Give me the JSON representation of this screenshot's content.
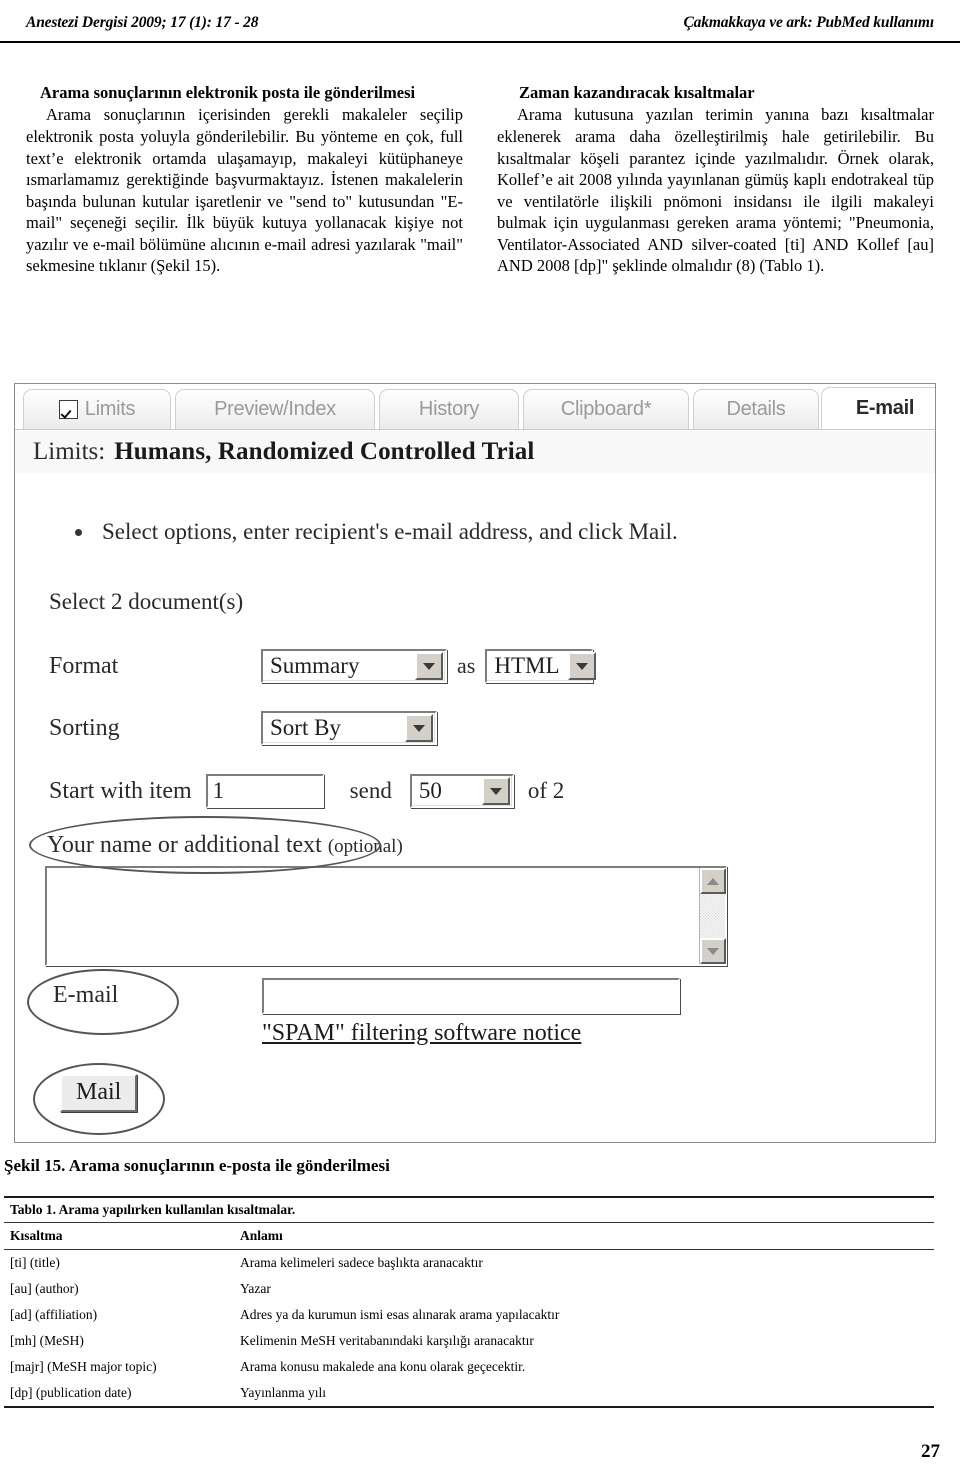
{
  "header": {
    "left": "Anestezi Dergisi 2009; 17 (1): 17 - 28",
    "right": "Çakmakkaya ve ark: PubMed kullanımı"
  },
  "left_column": {
    "heading": "Arama sonuçlarının elektronik posta ile gönderilmesi",
    "paragraph": "Arama sonuçlarının içerisinden gerekli makaleler seçilip elektronik posta yoluyla gönderilebilir. Bu yönteme en çok, full text’e elektronik ortamda ulaşamayıp, makaleyi kütüphaneye ısmarlamamız gerektiğinde başvurmaktayız. İstenen makalelerin başında bulunan kutular işaretlenir ve \"send to\" kutusundan \"E-mail\" seçeneği seçilir.  İlk büyük kutuya yollanacak kişiye not yazılır ve e-mail bölümüne alıcının e-mail adresi yazılarak \"mail\" sekmesine tıklanır (Şekil 15)."
  },
  "right_column": {
    "heading": "Zaman kazandıracak kısaltmalar",
    "paragraph": "Arama kutusuna yazılan terimin yanına bazı kısaltmalar eklenerek arama daha özelleştirilmiş hale getirilebilir. Bu kısaltmalar köşeli parantez içinde yazılmalıdır. Örnek olarak, Kollef’e ait 2008 yılında yayınlanan gümüş kaplı endotrakeal tüp ve ventilatörle ilişkili pnömoni insidansı ile ilgili makaleyi bulmak için uygulanması gereken arama yöntemi; \"Pneumonia, Ventilator-Associated AND silver-coated [ti] AND Kollef [au] AND 2008 [dp]\" şeklinde olmalıdır (8) (Tablo 1)."
  },
  "pubmed_figure": {
    "tabs": [
      {
        "label": "Limits",
        "has_checkbox": true,
        "checked": true,
        "active": false
      },
      {
        "label": "Preview/Index",
        "has_checkbox": false,
        "active": false
      },
      {
        "label": "History",
        "has_checkbox": false,
        "active": false
      },
      {
        "label": "Clipboard*",
        "has_checkbox": false,
        "active": false
      },
      {
        "label": "Details",
        "has_checkbox": false,
        "active": false
      },
      {
        "label": "E-mail",
        "has_checkbox": false,
        "active": true
      }
    ],
    "limits_bar": {
      "label": "Limits:",
      "value": "Humans, Randomized Controlled Trial"
    },
    "instruction": "Select options, enter recipient's e-mail address, and click Mail.",
    "select_count": "Select 2 document(s)",
    "format_row": {
      "label": "Format",
      "format_value": "Summary",
      "as_word": "as",
      "output_value": "HTML"
    },
    "sorting_row": {
      "label": "Sorting",
      "value": "Sort By"
    },
    "start_row": {
      "label": "Start with item",
      "item_value": "1",
      "send_word": "send",
      "count_value": "50",
      "of_word": "of 2"
    },
    "name_note": {
      "main": "Your name or additional text",
      "optional": "(optional)"
    },
    "textarea_value": "",
    "email_label": "E-mail",
    "email_value": "",
    "spam_notice": "\"SPAM\" filtering software notice",
    "mail_button": "Mail",
    "annotations": [
      "ellipse-around-name-note",
      "ellipse-around-email-label",
      "ellipse-around-mail-button"
    ]
  },
  "figure_caption": "Şekil 15. Arama sonuçlarının e-posta ile gönderilmesi",
  "table": {
    "title": "Tablo 1. Arama yapılırken kullanılan kısaltmalar.",
    "headers": [
      "Kısaltma",
      "Anlamı"
    ],
    "rows": [
      [
        "[ti] (title)",
        "Arama kelimeleri sadece başlıkta aranacaktır"
      ],
      [
        "[au] (author)",
        "Yazar"
      ],
      [
        "[ad] (affiliation)",
        "Adres ya da kurumun ismi esas alınarak arama yapılacaktır"
      ],
      [
        "[mh] (MeSH)",
        "Kelimenin MeSH veritabanındaki karşılığı aranacaktır"
      ],
      [
        "[majr] (MeSH major topic)",
        "Arama konusu makalede ana konu olarak geçecektir."
      ],
      [
        "[dp] (publication date)",
        "Yayınlanma yılı"
      ]
    ]
  },
  "page_number": "27"
}
